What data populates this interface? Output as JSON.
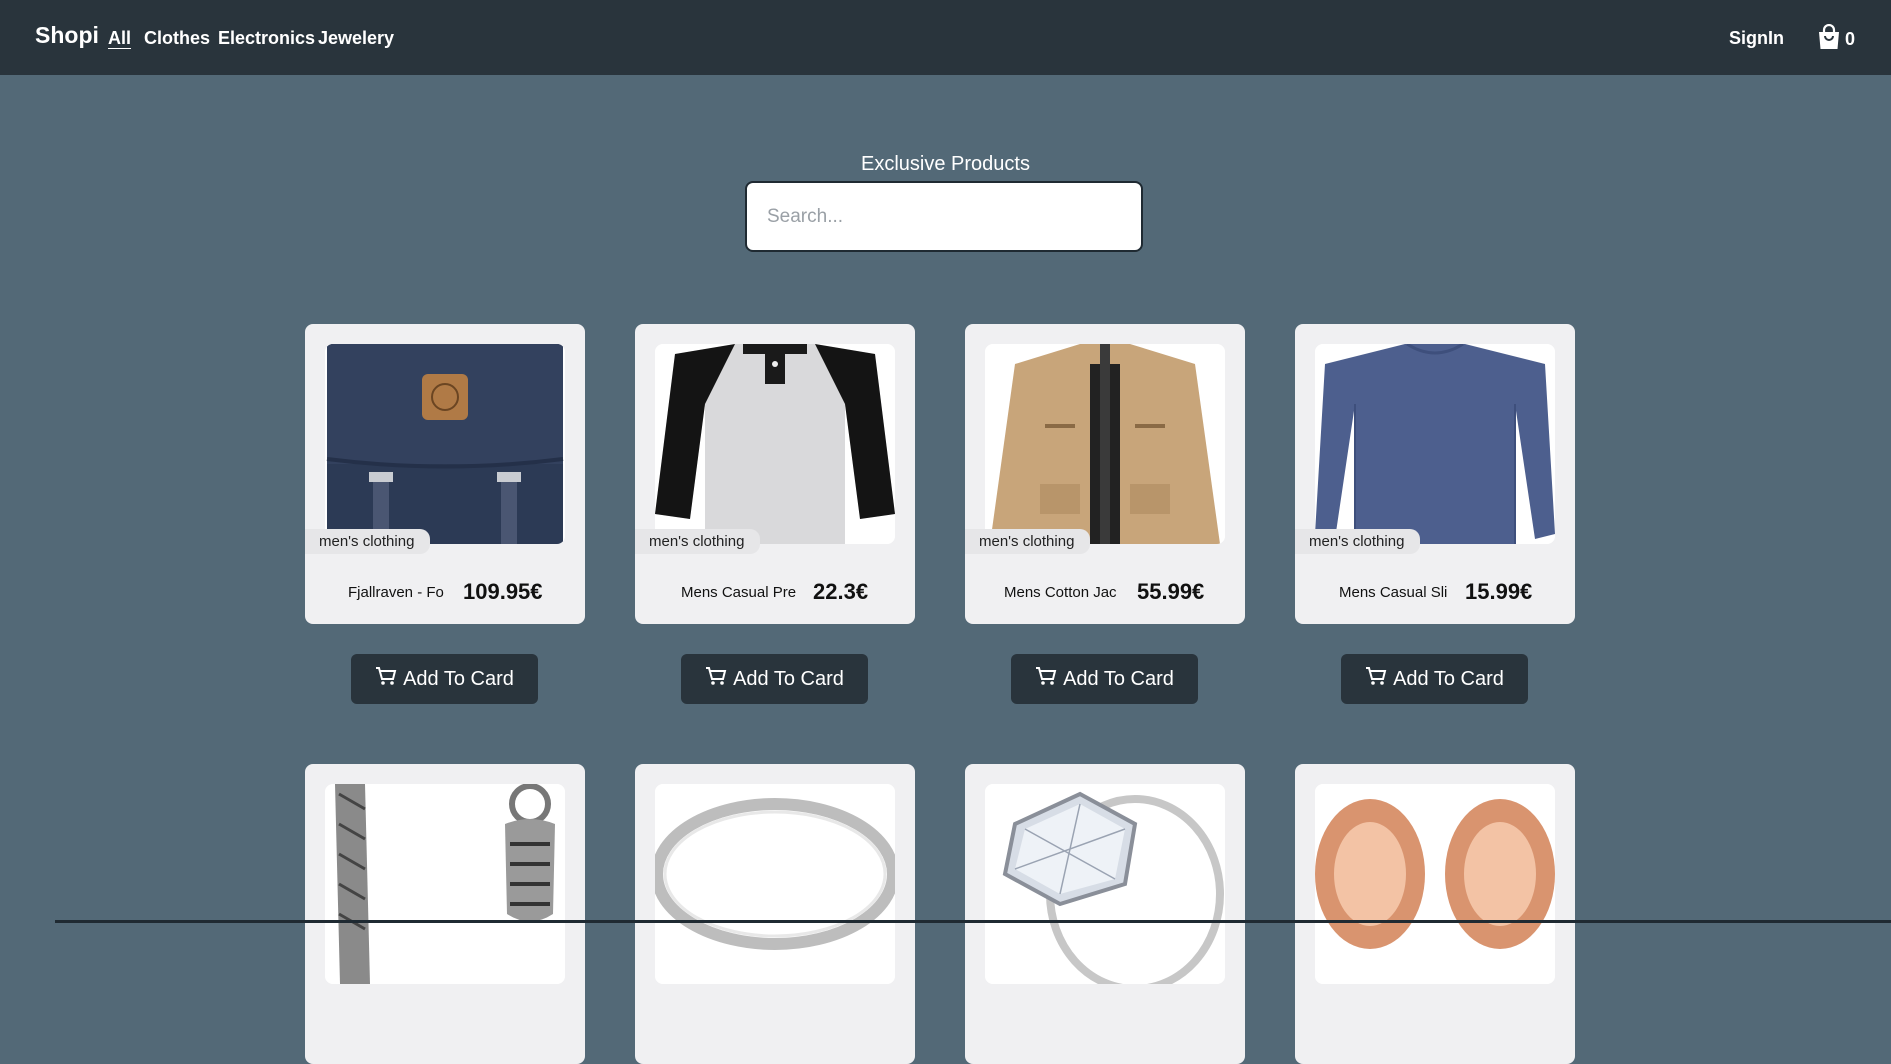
{
  "nav": {
    "brand": "Shopi",
    "links": [
      {
        "label": "All",
        "active": true
      },
      {
        "label": "Clothes"
      },
      {
        "label": "Electronics"
      },
      {
        "label": "Jewelery"
      }
    ],
    "signin": "SignIn",
    "cart_count": "0"
  },
  "main": {
    "heading": "Exclusive Products",
    "search_placeholder": "Search...",
    "add_button_label": "Add To Card"
  },
  "products": [
    {
      "category": "men's clothing",
      "title": "Fjallraven - Fo",
      "price": "109.95€",
      "image": "backpack"
    },
    {
      "category": "men's clothing",
      "title": "Mens Casual Pre",
      "price": "22.3€",
      "image": "raglan-shirt"
    },
    {
      "category": "men's clothing",
      "title": "Mens Cotton Jac",
      "price": "55.99€",
      "image": "jacket"
    },
    {
      "category": "men's clothing",
      "title": "Mens Casual Sli",
      "price": "15.99€",
      "image": "long-sleeve-shirt"
    },
    {
      "image": "chain-bracelet"
    },
    {
      "image": "silver-ring"
    },
    {
      "image": "diamond-ring"
    },
    {
      "image": "rose-gold-plugs"
    }
  ]
}
